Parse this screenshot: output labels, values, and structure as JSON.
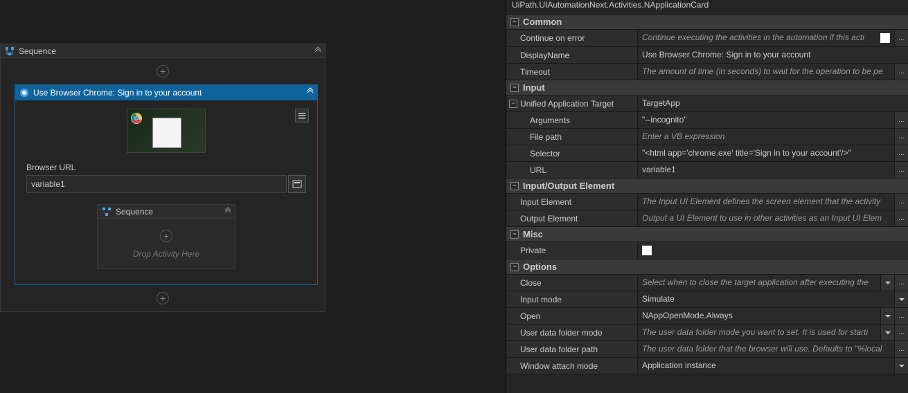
{
  "designer": {
    "outer_sequence_title": "Sequence",
    "activity_title": "Use Browser Chrome: Sign in to your account",
    "browser_url_label": "Browser URL",
    "browser_url_value": "variable1",
    "inner_sequence_title": "Sequence",
    "drop_hint": "Drop Activity Here"
  },
  "props": {
    "class_name": "UiPath.UIAutomationNext.Activities.NApplicationCard",
    "categories": [
      {
        "name": "Common",
        "rows": [
          {
            "label": "Continue on error",
            "placeholder": "Continue executing the activities in the automation if this acti",
            "check": true,
            "more": true
          },
          {
            "label": "DisplayName",
            "value": "Use Browser Chrome: Sign in to your account"
          },
          {
            "label": "Timeout",
            "placeholder": "The amount of time (in seconds) to wait for the operation to be pe",
            "more": true
          }
        ]
      },
      {
        "name": "Input",
        "rows": [
          {
            "label": "Unified Application Target",
            "value": "TargetApp",
            "expandable": true,
            "sub": [
              {
                "label": "Arguments",
                "value": "\"--incognito\"",
                "more": true
              },
              {
                "label": "File path",
                "placeholder": "Enter a VB expression",
                "more": true
              },
              {
                "label": "Selector",
                "value": "\"<html app='chrome.exe' title='Sign in to your account'/>\"",
                "more": true
              },
              {
                "label": "URL",
                "value": "variable1",
                "more": true
              }
            ]
          }
        ]
      },
      {
        "name": "Input/Output Element",
        "rows": [
          {
            "label": "Input Element",
            "placeholder": "The Input UI Element defines the screen element that the activity",
            "more": true
          },
          {
            "label": "Output Element",
            "placeholder": "Output a UI Element to use in other activities as an Input UI Elem",
            "more": true
          }
        ]
      },
      {
        "name": "Misc",
        "rows": [
          {
            "label": "Private",
            "checkbox": true
          }
        ]
      },
      {
        "name": "Options",
        "rows": [
          {
            "label": "Close",
            "placeholder": "Select when to close the target application after executing the",
            "dropdown": true,
            "more": true
          },
          {
            "label": "Input mode",
            "value": "Simulate",
            "dropdown": true
          },
          {
            "label": "Open",
            "value": "NAppOpenMode.Always",
            "dropdown": true,
            "more": true
          },
          {
            "label": "User data folder mode",
            "placeholder": "The user data folder mode you want to set. It is used for starti",
            "dropdown": true,
            "more": true
          },
          {
            "label": "User data folder path",
            "placeholder": "The user data folder that the browser will use. Defaults to \"%local",
            "more": true
          },
          {
            "label": "Window attach mode",
            "value": "Application instance",
            "dropdown": true
          }
        ]
      }
    ]
  }
}
